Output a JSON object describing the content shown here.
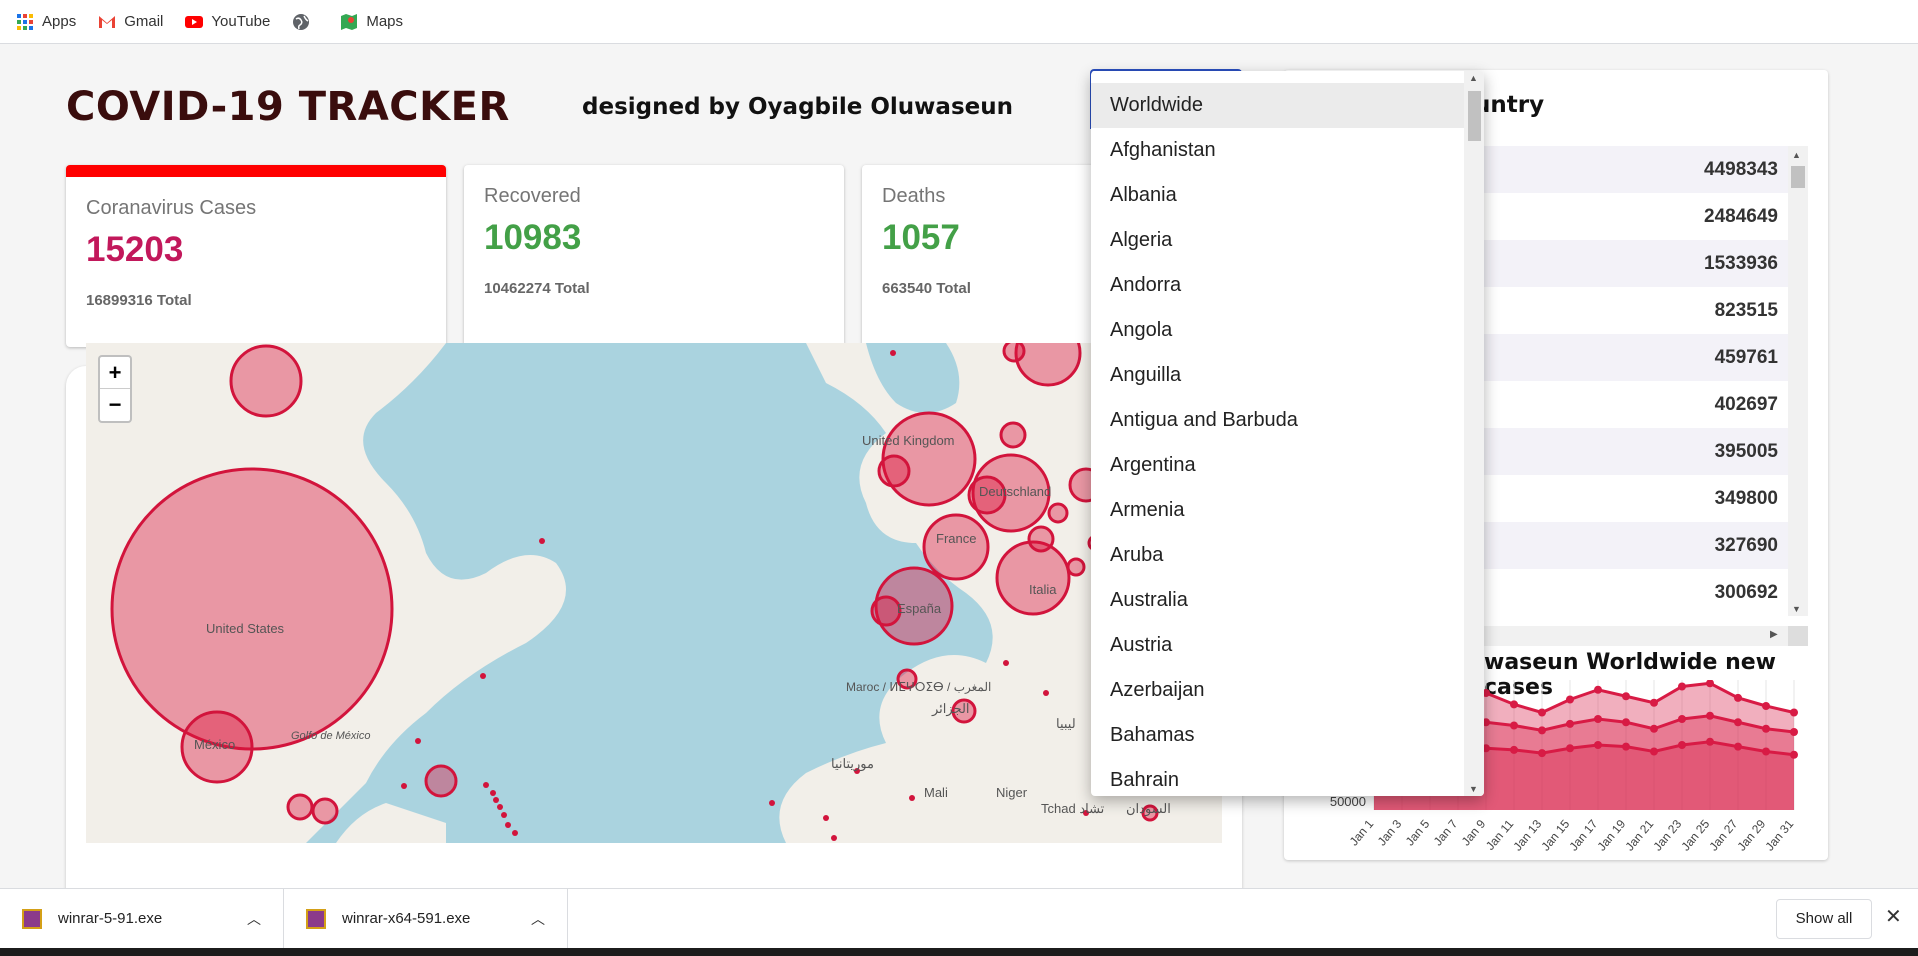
{
  "bookmarks": [
    {
      "label": "Apps",
      "icon": "apps-grid-icon"
    },
    {
      "label": "Gmail",
      "icon": "gmail-icon"
    },
    {
      "label": "YouTube",
      "icon": "youtube-icon"
    },
    {
      "label": "",
      "icon": "globe-icon"
    },
    {
      "label": "Maps",
      "icon": "maps-icon"
    }
  ],
  "header": {
    "title": "COVID-19 TRACKER",
    "designer": "designed by Oyagbile Oluwaseun"
  },
  "cards": [
    {
      "title": "Coranavirus Cases",
      "value": "15203",
      "total": "16899316 Total",
      "color": "#c2185b"
    },
    {
      "title": "Recovered",
      "value": "10983",
      "total": "10462274 Total",
      "color": "#43a047"
    },
    {
      "title": "Deaths",
      "value": "1057",
      "total": "663540 Total",
      "color": "#43a047"
    }
  ],
  "map": {
    "labels": [
      "United States",
      "United Kingdom",
      "Deutschland",
      "France",
      "España",
      "Italia",
      "Maroc / ⵍⵎⵖⵔⵉⴱ / المغرب",
      "الجزائر",
      "ليبيا",
      "موريتانيا",
      "Mali",
      "Niger",
      "Tchad تشاد",
      "السودان",
      "México",
      "Golfo de México"
    ],
    "zoom_in": "+",
    "zoom_out": "−"
  },
  "right": {
    "title": "untry",
    "table_values": [
      "4498343",
      "2484649",
      "1533936",
      "823515",
      "459761",
      "402697",
      "395005",
      "349800",
      "327690",
      "300692"
    ],
    "chart_title": "waseun Worldwide new cases"
  },
  "chart_data": {
    "type": "line",
    "title": "",
    "x": [
      "Jan 1",
      "Jan 3",
      "Jan 5",
      "Jan 7",
      "Jan 9",
      "Jan 11",
      "Jan 13",
      "Jan 15",
      "Jan 17",
      "Jan 19",
      "Jan 21",
      "Jan 23",
      "Jan 25",
      "Jan 27",
      "Jan 29",
      "Jan 31"
    ],
    "y_tick": "50000",
    "series": [
      {
        "values": [
          460000,
          540000,
          620000,
          700000,
          720000,
          650000,
          600000,
          680000,
          740000,
          700000,
          660000,
          760000,
          780000,
          690000,
          640000,
          600000
        ]
      },
      {
        "values": [
          380000,
          420000,
          460000,
          500000,
          540000,
          520000,
          490000,
          530000,
          560000,
          540000,
          500000,
          560000,
          580000,
          540000,
          500000,
          480000
        ]
      },
      {
        "values": [
          260000,
          300000,
          340000,
          360000,
          380000,
          370000,
          350000,
          380000,
          400000,
          390000,
          360000,
          400000,
          420000,
          390000,
          360000,
          340000
        ]
      }
    ],
    "color": "#d81b45"
  },
  "dropdown": {
    "items": [
      "Worldwide",
      "Afghanistan",
      "Albania",
      "Algeria",
      "Andorra",
      "Angola",
      "Anguilla",
      "Antigua and Barbuda",
      "Argentina",
      "Armenia",
      "Aruba",
      "Australia",
      "Austria",
      "Azerbaijan",
      "Bahamas",
      "Bahrain"
    ],
    "highlighted": "Worldwide"
  },
  "downloads": {
    "items": [
      "winrar-5-91.exe",
      "winrar-x64-591.exe"
    ],
    "show_all": "Show all"
  }
}
